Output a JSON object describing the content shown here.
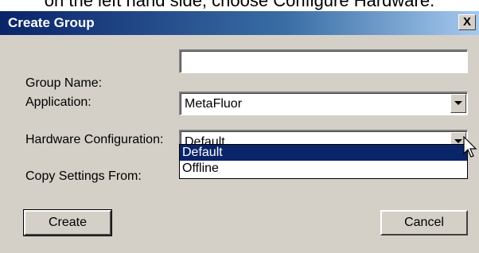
{
  "caption": "on the left hand side, choose Configure Hardware.",
  "dialog": {
    "title": "Create Group",
    "close_label": "X"
  },
  "form": {
    "group_name_label": "Group Name:",
    "group_name_value": "",
    "application_label": "Application:",
    "application_value": "MetaFluor",
    "hardware_label": "Hardware Configuration:",
    "hardware_value": "Default",
    "copy_label": "Copy Settings From:"
  },
  "dropdown": {
    "options": [
      "Default",
      "Offline"
    ],
    "selected": "Default"
  },
  "buttons": {
    "create_label": "Create",
    "cancel_label": "Cancel"
  },
  "colors": {
    "titlebar_start": "#0a246a",
    "titlebar_end": "#a6caf0",
    "selection": "#0a246a",
    "face": "#d4d0c8"
  },
  "icons": {
    "cursor": "mouse-pointer-icon",
    "dropdown_arrow": "chevron-down-icon"
  }
}
